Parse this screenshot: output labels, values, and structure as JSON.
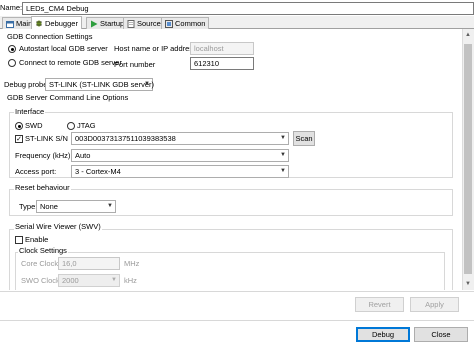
{
  "name_row": {
    "label": "Name:",
    "value": "LEDs_CM4 Debug"
  },
  "tabs": [
    {
      "label": "Main",
      "icon": "main-tab-icon",
      "active": false
    },
    {
      "label": "Debugger",
      "icon": "debugger-tab-icon",
      "active": true
    },
    {
      "label": "Startup",
      "icon": "startup-tab-icon",
      "active": false
    },
    {
      "label": "Source",
      "icon": "source-tab-icon",
      "active": false
    },
    {
      "label": "Common",
      "icon": "common-tab-icon",
      "active": false
    }
  ],
  "gdb": {
    "title": "GDB Connection Settings",
    "autostart_label": "Autostart local GDB server",
    "connect_remote_label": "Connect to remote GDB server",
    "host_label": "Host name or IP address",
    "host_placeholder": "localhost",
    "port_label": "Port number",
    "port_value": "612310"
  },
  "probe": {
    "label": "Debug probe",
    "value": "ST-LINK (ST-LINK GDB server)"
  },
  "server_options": {
    "title": "GDB Server Command Line Options",
    "interface": {
      "title": "Interface",
      "swd": "SWD",
      "jtag": "JTAG"
    },
    "stlink_sn_label": "ST-LINK S/N",
    "stlink_sn_value": "003D00373137511039383538",
    "scan_label": "Scan",
    "frequency_label": "Frequency (kHz):",
    "frequency_value": "Auto",
    "access_port_label": "Access port:",
    "access_port_value": "3 - Cortex-M4"
  },
  "reset": {
    "title": "Reset behaviour",
    "type_label": "Type:",
    "type_value": "None"
  },
  "swv": {
    "title": "Serial Wire Viewer (SWV)",
    "enable_label": "Enable",
    "clock_title": "Clock Settings",
    "core_clock_label": "Core Clock:",
    "core_clock_value": "16,0",
    "core_clock_unit": "MHz",
    "swo_clock_label": "SWO Clock:",
    "swo_clock_value": "2000",
    "swo_clock_unit": "kHz"
  },
  "footer": {
    "revert": "Revert",
    "apply": "Apply",
    "debug": "Debug",
    "close": "Close"
  }
}
